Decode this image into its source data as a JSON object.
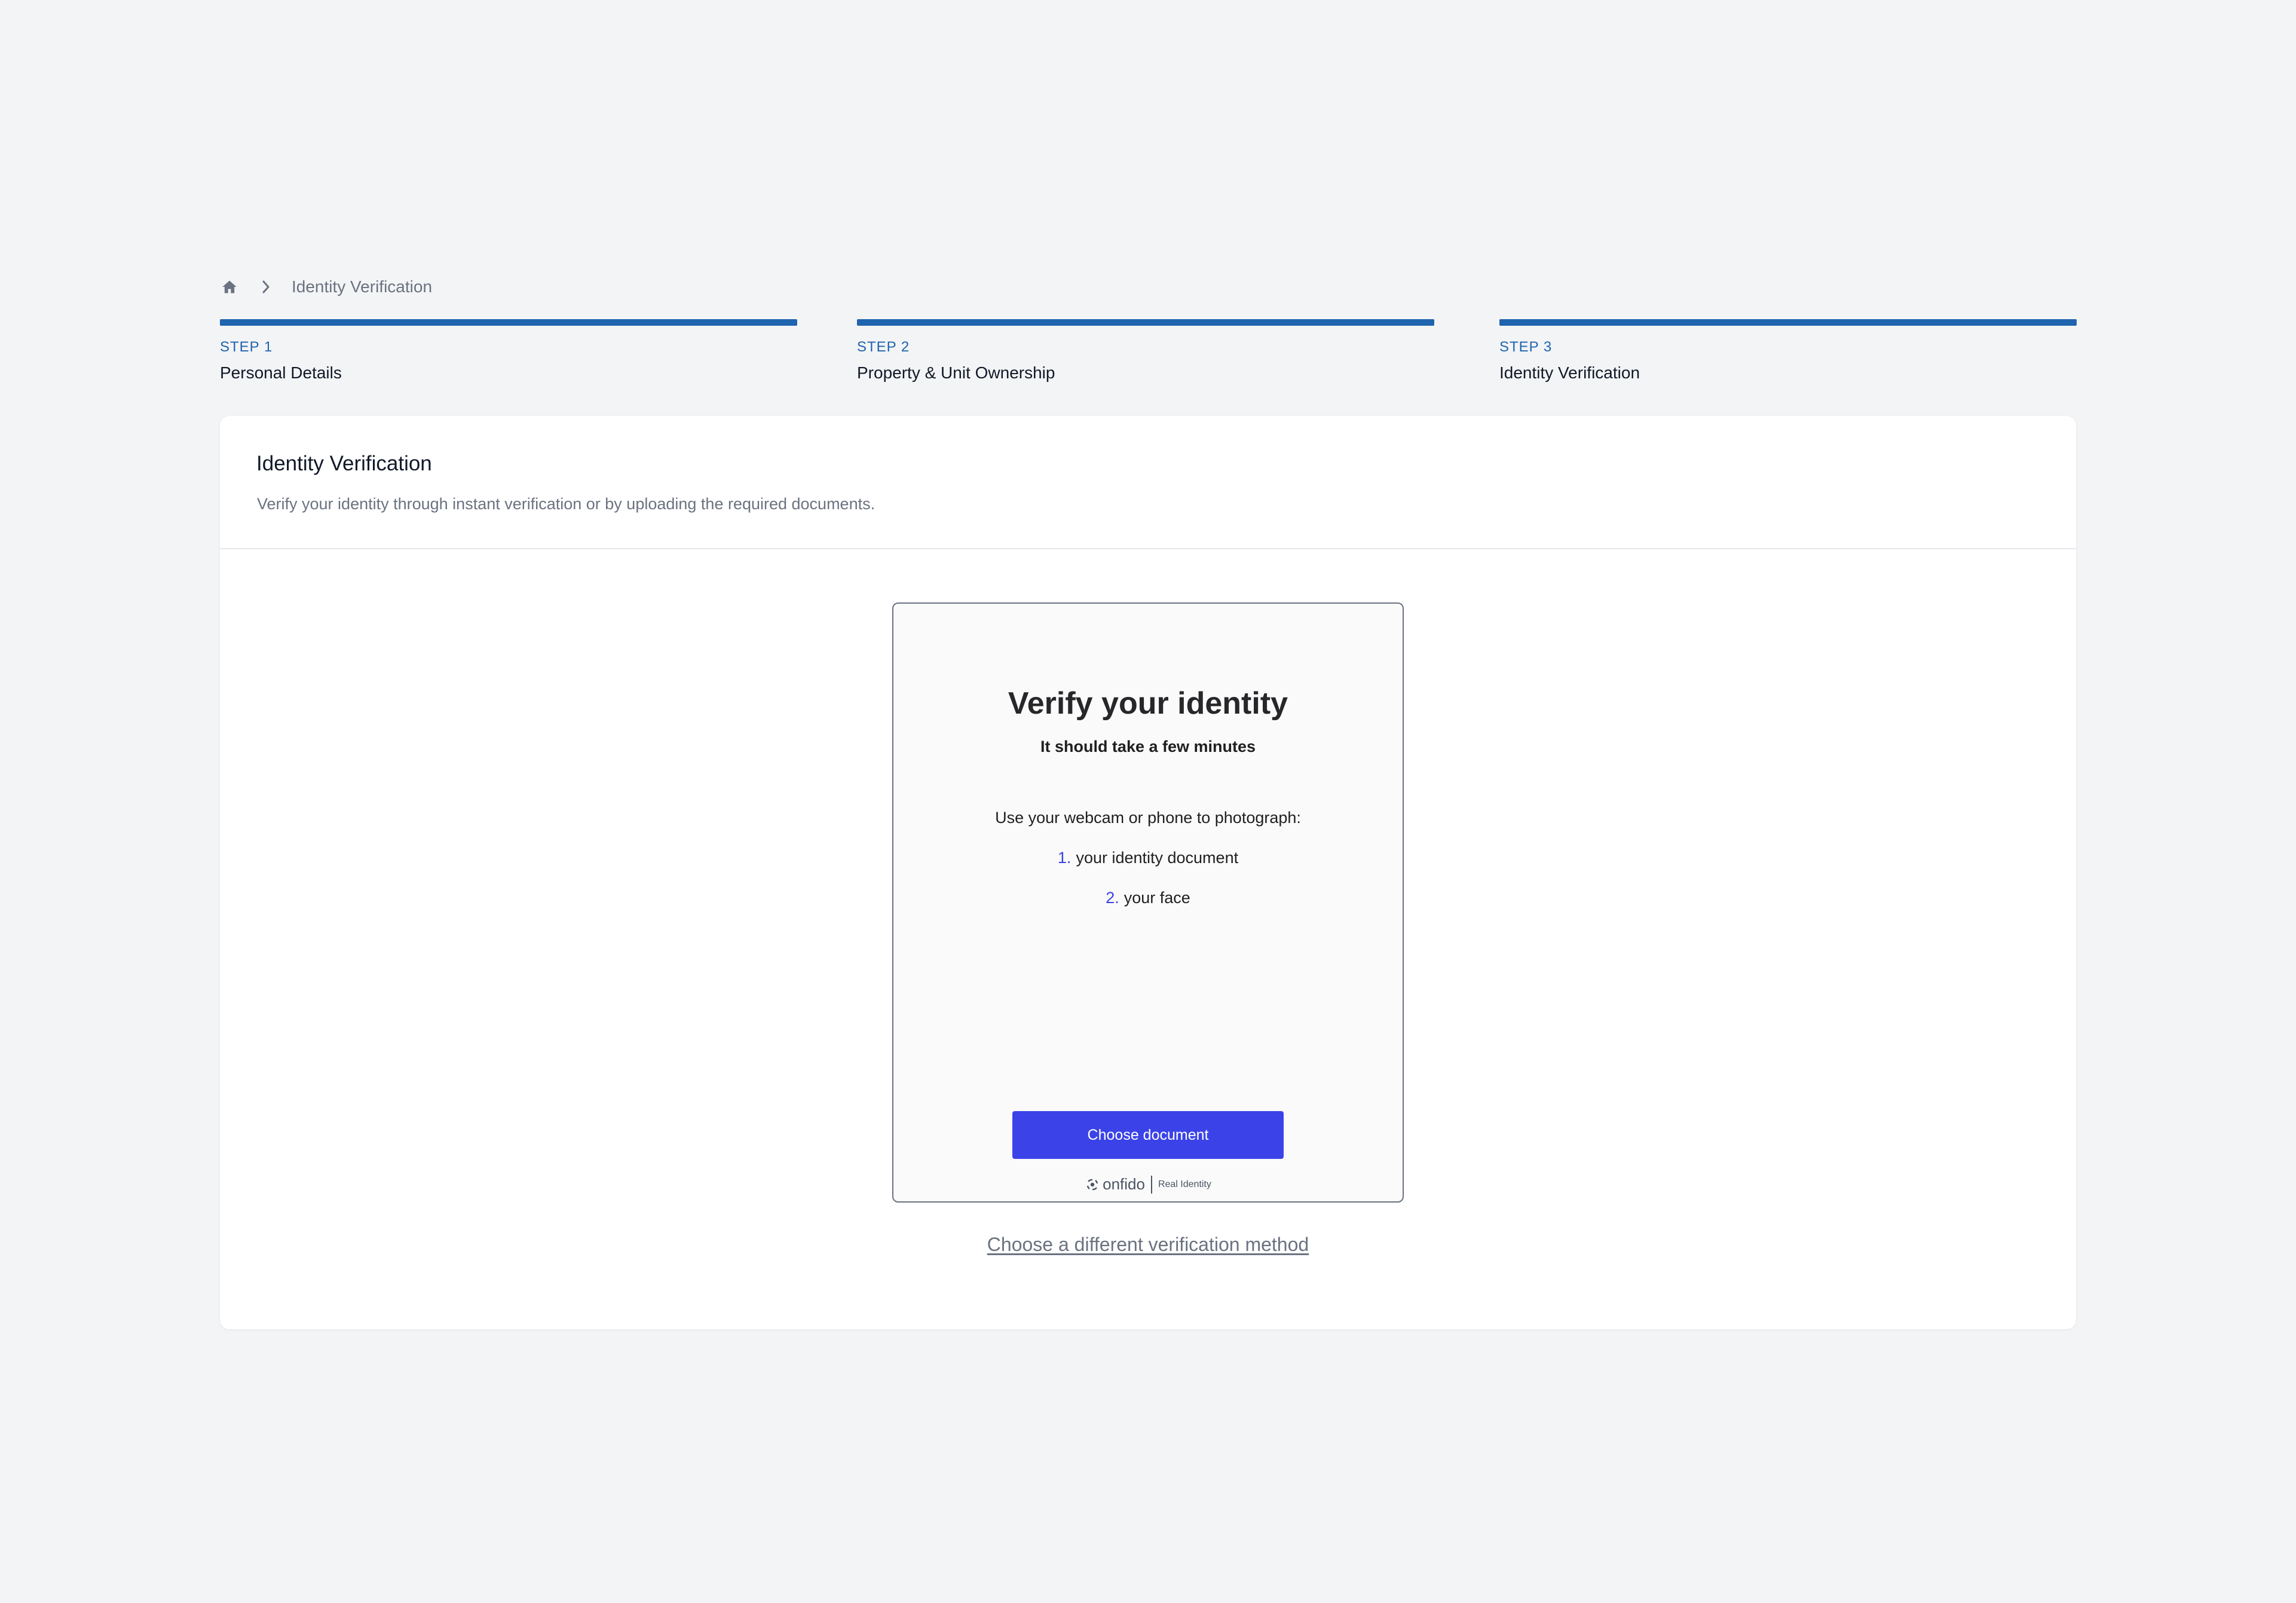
{
  "breadcrumb": {
    "home_icon": "home-icon",
    "separator_icon": "chevron-right-icon",
    "current": "Identity Verification"
  },
  "stepper": {
    "active_color": "#1f64ae",
    "steps": [
      {
        "number": "STEP 1",
        "name": "Personal Details"
      },
      {
        "number": "STEP 2",
        "name": "Property & Unit Ownership"
      },
      {
        "number": "STEP 3",
        "name": "Identity Verification"
      }
    ]
  },
  "card": {
    "title": "Identity Verification",
    "description": "Verify your identity through instant verification or by uploading the required documents."
  },
  "onfido": {
    "title": "Verify your identity",
    "subtitle": "It should take a few minutes",
    "intro": "Use your webcam or phone to photograph:",
    "items": [
      {
        "number": "1.",
        "text": "your identity document"
      },
      {
        "number": "2.",
        "text": "your face"
      }
    ],
    "button_label": "Choose document",
    "button_color": "#3b43e8",
    "brand_name": "onfido",
    "brand_tag": "Real Identity"
  },
  "alt_method_link": "Choose a different verification method"
}
